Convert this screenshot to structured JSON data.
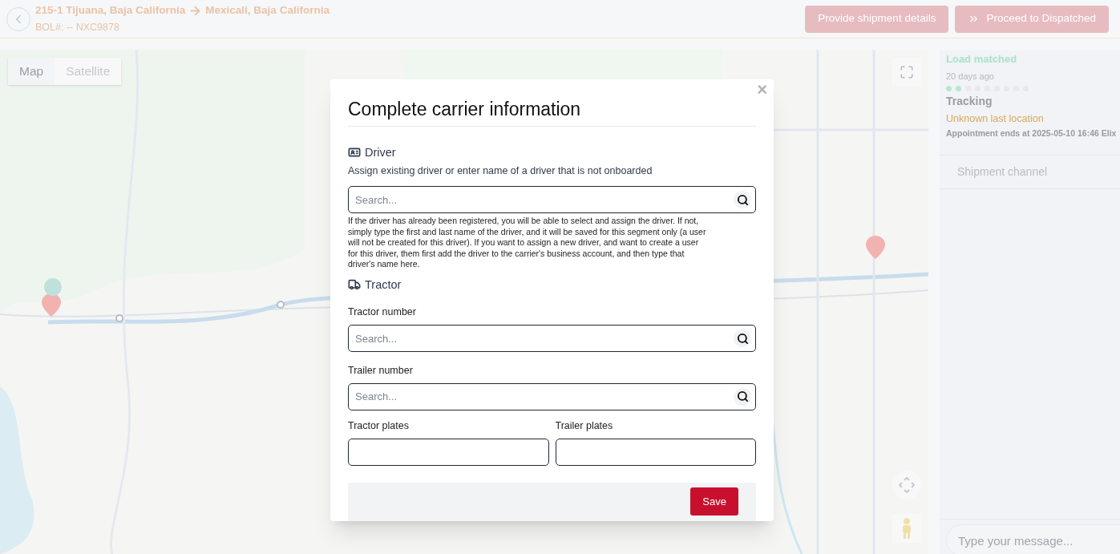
{
  "header": {
    "route_from": "215-1 Tijuana, Baja California",
    "route_to": "Mexicali, Baja California",
    "bol": "BOL#: -- NXC9878",
    "buttons": [
      {
        "label": "Provide shipment details",
        "kind": "plain"
      },
      {
        "label": "Proceed to Dispatched",
        "kind": "proceed"
      }
    ]
  },
  "map": {
    "kind": "picture",
    "tabs": [
      {
        "label": "Map",
        "selected": true
      },
      {
        "label": "Satellite",
        "selected": false
      }
    ]
  },
  "status_panel": {
    "milestone": "Load matched",
    "age": "20 days ago",
    "steps": [
      {
        "done": true
      },
      {
        "done": true
      },
      {
        "done": false
      },
      {
        "done": false
      },
      {
        "done": false
      },
      {
        "done": false
      },
      {
        "done": false
      },
      {
        "done": false
      },
      {
        "done": false
      }
    ],
    "tracking_title": "Tracking",
    "location": "Unknown last location",
    "appointment": "Appointment ends at 2025-05-10 16:46 Elix"
  },
  "chat": {
    "title": "Shipment channel",
    "placeholder": "Type your message..."
  },
  "dialog": {
    "title": "Complete carrier information",
    "close": "×",
    "driver": {
      "title": "Driver",
      "subtitle": "Assign existing driver or enter name of a driver that is not onboarded",
      "placeholder": "Search...",
      "help": "If the driver has already been registered, you will be able to select and assign the driver. If not, simply type the first and last name of the driver, and it will be saved for this segment only (a user will not be created for this driver). If you want to assign a new driver, and want to create a user for this driver, them first add the driver to the carrier's business account, and then type that driver's name here."
    },
    "tractor": {
      "title": "Tractor",
      "fields": [
        {
          "label": "Tractor number",
          "placeholder": "Search...",
          "kind": "search"
        },
        {
          "label": "Trailer number",
          "placeholder": "Search...",
          "kind": "search"
        }
      ],
      "plates": [
        {
          "label": "Tractor plates"
        },
        {
          "label": "Trailer plates"
        }
      ]
    },
    "save": "Save"
  }
}
